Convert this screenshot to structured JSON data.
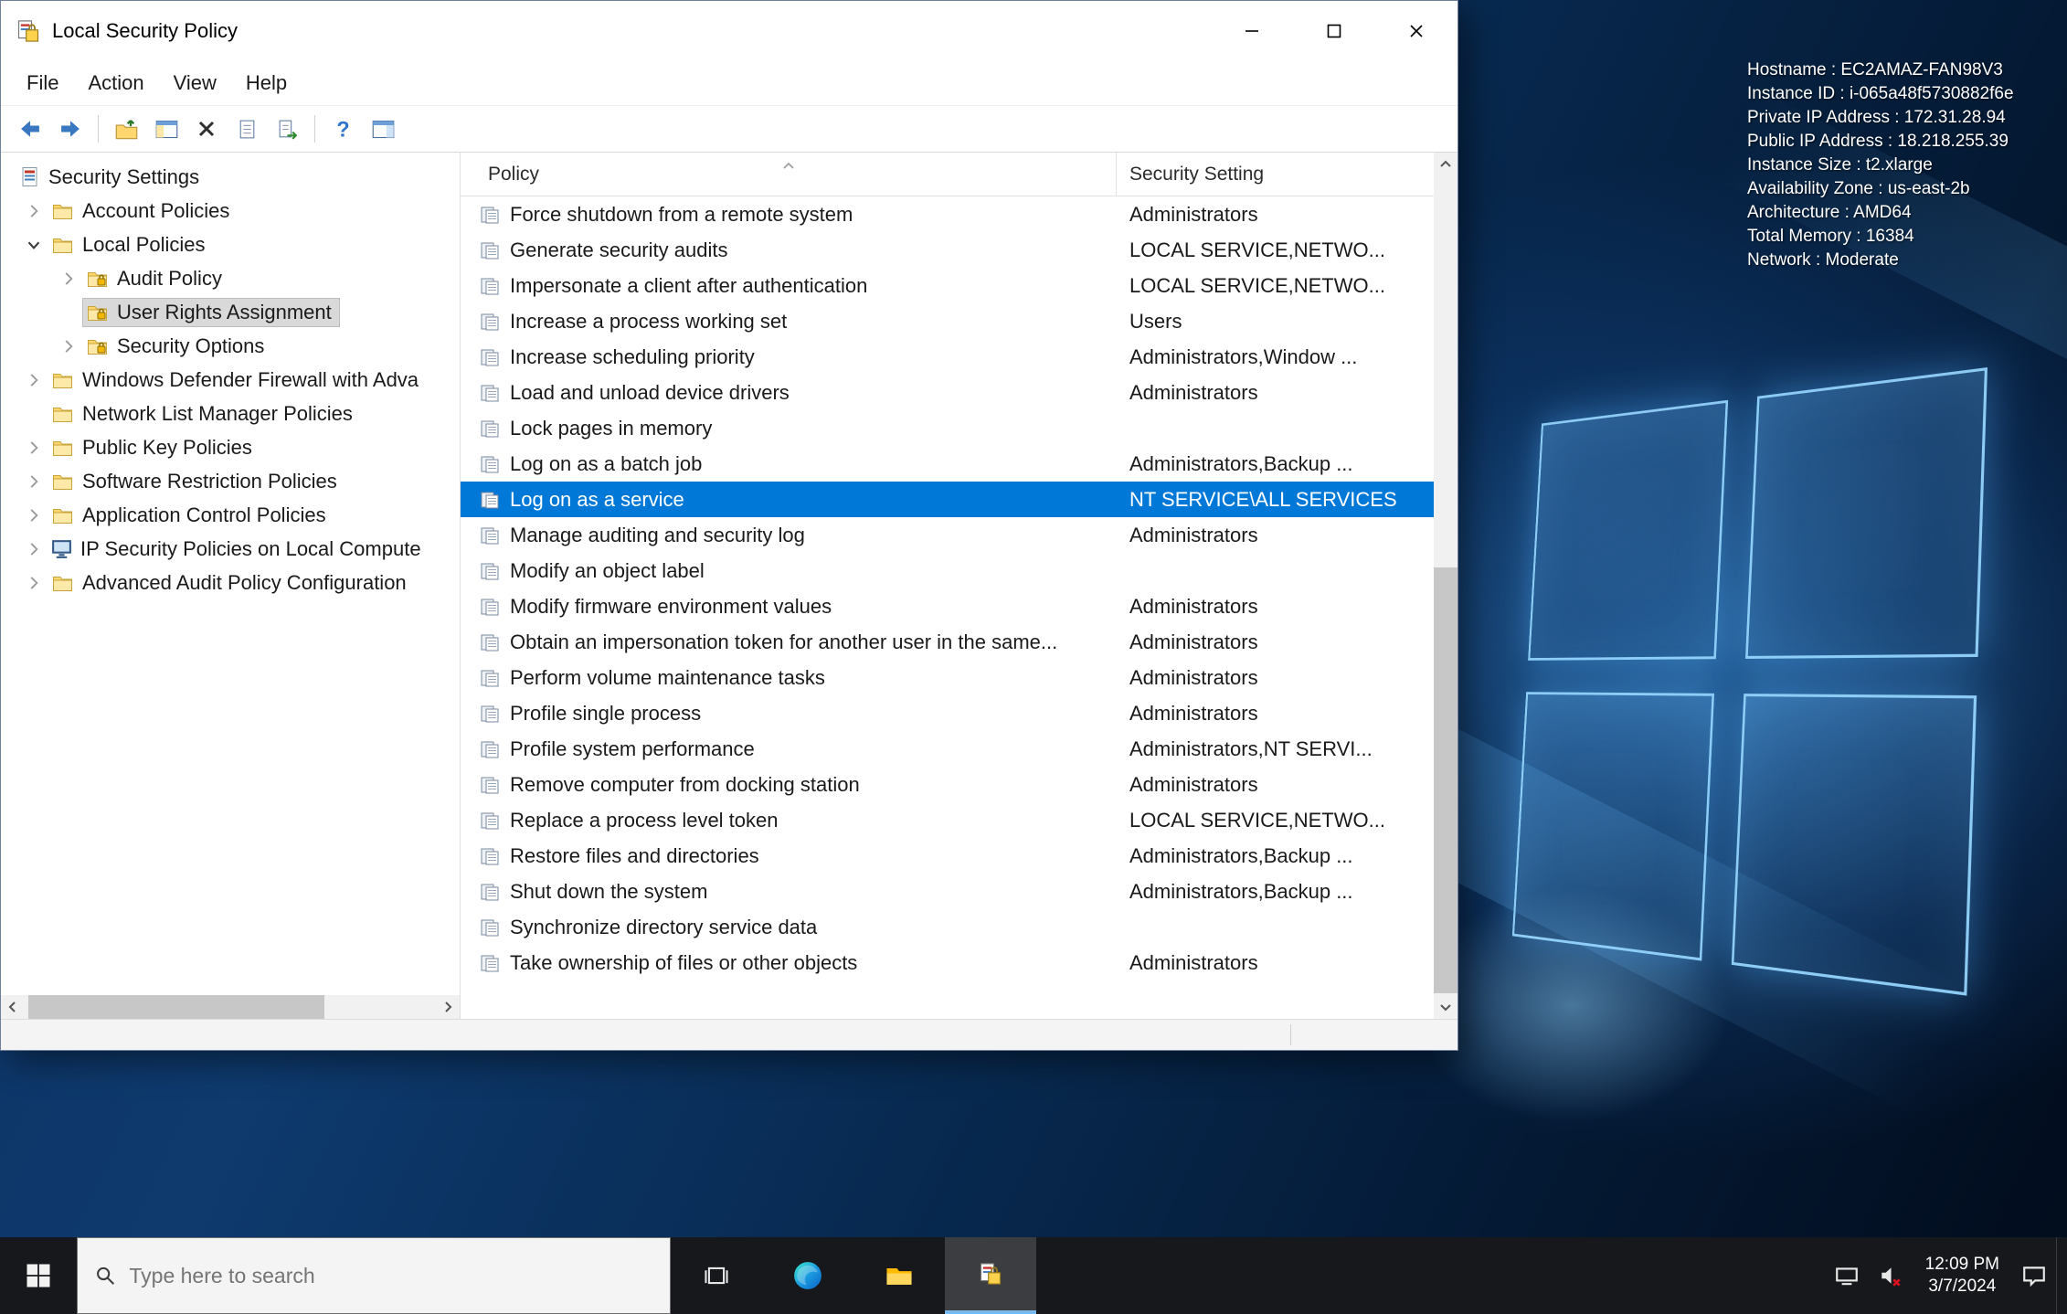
{
  "desktop": {
    "bginfo": [
      "Hostname : EC2AMAZ-FAN98V3",
      "Instance ID : i-065a48f5730882f6e",
      "Private IP Address : 172.31.28.94",
      "Public IP Address : 18.218.255.39",
      "Instance Size : t2.xlarge",
      "Availability Zone : us-east-2b",
      "Architecture : AMD64",
      "Total Memory : 16384",
      "Network : Moderate"
    ]
  },
  "window": {
    "title": "Local Security Policy",
    "menu": [
      "File",
      "Action",
      "View",
      "Help"
    ],
    "toolbar": [
      "back-icon",
      "forward-icon",
      "sep",
      "folder-up-icon",
      "console-tree-icon",
      "delete-icon",
      "export-list-icon",
      "doc-arrow-icon",
      "sep",
      "help-icon",
      "panes-icon"
    ],
    "tree": {
      "items": [
        {
          "label": "Security Settings",
          "indent": 0,
          "chevron": "none",
          "icon": "root",
          "selected": false
        },
        {
          "label": "Account Policies",
          "indent": 1,
          "chevron": "right",
          "icon": "folder",
          "selected": false
        },
        {
          "label": "Local Policies",
          "indent": 1,
          "chevron": "down",
          "icon": "folder",
          "selected": false
        },
        {
          "label": "Audit Policy",
          "indent": 2,
          "chevron": "right",
          "icon": "folder-lock",
          "selected": false
        },
        {
          "label": "User Rights Assignment",
          "indent": 2,
          "chevron": "none",
          "icon": "folder-lock",
          "selected": true
        },
        {
          "label": "Security Options",
          "indent": 2,
          "chevron": "right",
          "icon": "folder-lock",
          "selected": false
        },
        {
          "label": "Windows Defender Firewall with Adva",
          "indent": 1,
          "chevron": "right",
          "icon": "folder",
          "selected": false
        },
        {
          "label": "Network List Manager Policies",
          "indent": 1,
          "chevron": "none",
          "icon": "folder",
          "selected": false
        },
        {
          "label": "Public Key Policies",
          "indent": 1,
          "chevron": "right",
          "icon": "folder",
          "selected": false
        },
        {
          "label": "Software Restriction Policies",
          "indent": 1,
          "chevron": "right",
          "icon": "folder",
          "selected": false
        },
        {
          "label": "Application Control Policies",
          "indent": 1,
          "chevron": "right",
          "icon": "folder",
          "selected": false
        },
        {
          "label": "IP Security Policies on Local Compute",
          "indent": 1,
          "chevron": "right",
          "icon": "ipsec",
          "selected": false
        },
        {
          "label": "Advanced Audit Policy Configuration",
          "indent": 1,
          "chevron": "right",
          "icon": "folder",
          "selected": false
        }
      ]
    },
    "list": {
      "columns": [
        "Policy",
        "Security Setting"
      ],
      "sort_column": "Policy",
      "rows": [
        {
          "policy": "Force shutdown from a remote system",
          "setting": "Administrators",
          "selected": false
        },
        {
          "policy": "Generate security audits",
          "setting": "LOCAL SERVICE,NETWO...",
          "selected": false
        },
        {
          "policy": "Impersonate a client after authentication",
          "setting": "LOCAL SERVICE,NETWO...",
          "selected": false
        },
        {
          "policy": "Increase a process working set",
          "setting": "Users",
          "selected": false
        },
        {
          "policy": "Increase scheduling priority",
          "setting": "Administrators,Window ...",
          "selected": false
        },
        {
          "policy": "Load and unload device drivers",
          "setting": "Administrators",
          "selected": false
        },
        {
          "policy": "Lock pages in memory",
          "setting": "",
          "selected": false
        },
        {
          "policy": "Log on as a batch job",
          "setting": "Administrators,Backup ...",
          "selected": false
        },
        {
          "policy": "Log on as a service",
          "setting": "NT SERVICE\\ALL SERVICES",
          "selected": true
        },
        {
          "policy": "Manage auditing and security log",
          "setting": "Administrators",
          "selected": false
        },
        {
          "policy": "Modify an object label",
          "setting": "",
          "selected": false
        },
        {
          "policy": "Modify firmware environment values",
          "setting": "Administrators",
          "selected": false
        },
        {
          "policy": "Obtain an impersonation token for another user in the same...",
          "setting": "Administrators",
          "selected": false
        },
        {
          "policy": "Perform volume maintenance tasks",
          "setting": "Administrators",
          "selected": false
        },
        {
          "policy": "Profile single process",
          "setting": "Administrators",
          "selected": false
        },
        {
          "policy": "Profile system performance",
          "setting": "Administrators,NT SERVI...",
          "selected": false
        },
        {
          "policy": "Remove computer from docking station",
          "setting": "Administrators",
          "selected": false
        },
        {
          "policy": "Replace a process level token",
          "setting": "LOCAL SERVICE,NETWO...",
          "selected": false
        },
        {
          "policy": "Restore files and directories",
          "setting": "Administrators,Backup ...",
          "selected": false
        },
        {
          "policy": "Shut down the system",
          "setting": "Administrators,Backup ...",
          "selected": false
        },
        {
          "policy": "Synchronize directory service data",
          "setting": "",
          "selected": false
        },
        {
          "policy": "Take ownership of files or other objects",
          "setting": "Administrators",
          "selected": false
        }
      ]
    }
  },
  "taskbar": {
    "search_placeholder": "Type here to search",
    "clock": {
      "time": "12:09 PM",
      "date": "3/7/2024"
    }
  },
  "colors": {
    "selection_blue": "#0078d7",
    "tree_inactive_selection": "#d9d9d9",
    "taskbar_bg": "#16181c"
  }
}
